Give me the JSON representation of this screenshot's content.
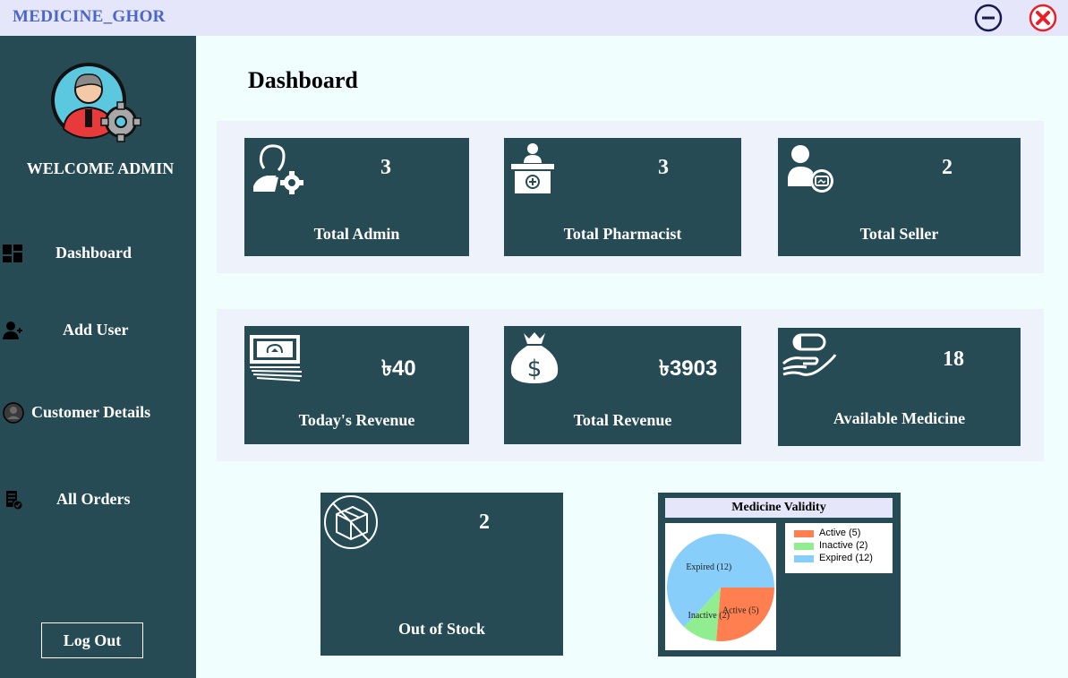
{
  "app": {
    "title": "MEDICINE_GHOR",
    "minimize_icon": "minimize-circle-icon",
    "close_icon": "close-circle-icon"
  },
  "sidebar": {
    "avatar_icon": "admin-avatar-gear-icon",
    "welcome": "WELCOME ADMIN",
    "items": [
      {
        "label": "Dashboard",
        "icon": "dashboard-icon"
      },
      {
        "label": "Add User",
        "icon": "add-user-icon"
      },
      {
        "label": "Customer Details",
        "icon": "customer-icon"
      },
      {
        "label": "All Orders",
        "icon": "orders-icon"
      }
    ],
    "logout": "Log Out"
  },
  "main": {
    "title": "Dashboard",
    "cards": [
      {
        "label": "Total Admin",
        "value": "3",
        "icon": "admin-gear-icon"
      },
      {
        "label": "Total Pharmacist",
        "value": "3",
        "icon": "pharmacist-counter-icon"
      },
      {
        "label": "Total Seller",
        "value": "2",
        "icon": "seller-icon"
      },
      {
        "label": "Today's Revenue",
        "value": "৳40",
        "icon": "cash-icon"
      },
      {
        "label": "Total Revenue",
        "value": "৳3903",
        "icon": "money-bag-icon"
      },
      {
        "label": "Available Medicine",
        "value": "18",
        "icon": "pill-hand-icon"
      },
      {
        "label": "Out of Stock",
        "value": "2",
        "icon": "out-of-stock-box-icon"
      }
    ]
  },
  "chart_data": {
    "type": "pie",
    "title": "Medicine Validity",
    "categories": [
      "Active",
      "Inactive",
      "Expired"
    ],
    "values": [
      5,
      2,
      12
    ],
    "legend": [
      "Active (5)",
      "Inactive (2)",
      "Expired (12)"
    ],
    "colors": [
      "#ff7f50",
      "#90ee90",
      "#87cefa"
    ],
    "legend_position": "right"
  }
}
